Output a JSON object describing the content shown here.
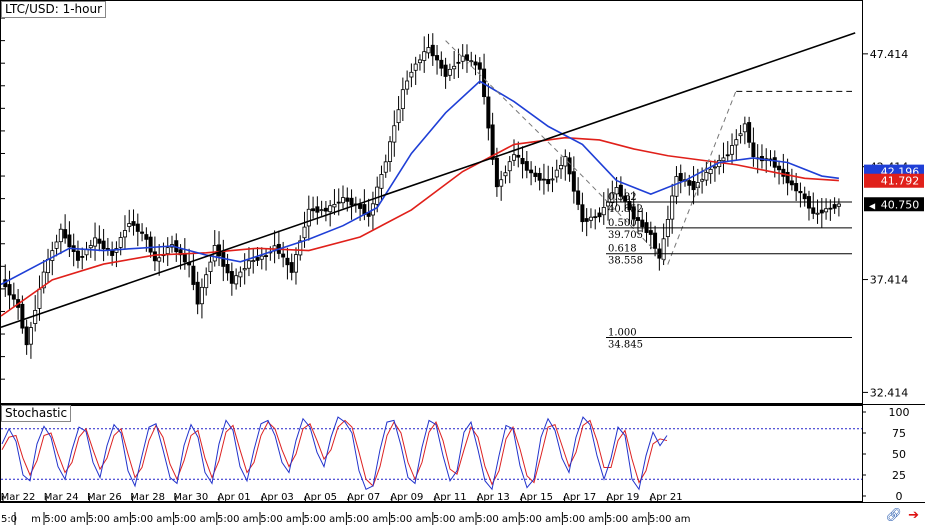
{
  "chart_data": {
    "type": "candlestick",
    "title": "LTC/USD: 1-hour",
    "price_axis": {
      "ticks": [
        "47.414",
        "42.414",
        "37.414",
        "32.414"
      ],
      "ylim": [
        31.9,
        49.8
      ]
    },
    "price_labels": {
      "ma_blue": "42.196",
      "ma_red": "41.792",
      "last": "40.750"
    },
    "colors": {
      "ma_blue": "#1f3fd6",
      "ma_red": "#e0201a",
      "last_label_bg": "#000000",
      "stoch_k": "#2233cc",
      "stoch_d": "#dd2222",
      "stoch_levels": "#2222cc"
    },
    "fib_levels": [
      {
        "ratio": "0.382",
        "price": "40.852"
      },
      {
        "ratio": "0.500",
        "price": "39.705"
      },
      {
        "ratio": "0.618",
        "price": "38.558"
      },
      {
        "ratio": "1.000",
        "price": "34.845"
      }
    ],
    "dates": [
      "Mar 22",
      "Mar 24",
      "Mar 26",
      "Mar 28",
      "Mar 30",
      "Apr 01",
      "Apr 03",
      "Apr 05",
      "Apr 07",
      "Apr 09",
      "Apr 11",
      "Apr 13",
      "Apr 15",
      "Apr 17",
      "Apr 19",
      "Apr 21"
    ],
    "times": [
      "5:0",
      "m",
      "5:00 am",
      "5:00 am",
      "5:00 am",
      "5:00 am",
      "5:00 am",
      "5:00 am",
      "5:00 am",
      "5:00 am",
      "5:00 am",
      "5:00 am",
      "5:00 am",
      "5:00 am",
      "5:00 am",
      "5:00 am",
      "5:00 am"
    ],
    "price_series": [
      [
        0,
        37.4
      ],
      [
        2,
        36.2
      ],
      [
        3,
        34.5
      ],
      [
        5,
        37.8
      ],
      [
        7,
        39.6
      ],
      [
        9,
        38.3
      ],
      [
        11,
        39.2
      ],
      [
        13,
        38.5
      ],
      [
        15,
        40.0
      ],
      [
        17,
        39.2
      ],
      [
        18,
        38.2
      ],
      [
        20,
        39.0
      ],
      [
        22,
        38.0
      ],
      [
        23,
        36.4
      ],
      [
        25,
        38.9
      ],
      [
        27,
        37.3
      ],
      [
        29,
        38.2
      ],
      [
        31,
        38.5
      ],
      [
        32,
        38.9
      ],
      [
        34,
        37.8
      ],
      [
        36,
        40.5
      ],
      [
        38,
        40.5
      ],
      [
        40,
        41.0
      ],
      [
        42,
        40.6
      ],
      [
        43,
        40.2
      ],
      [
        45,
        42.7
      ],
      [
        47,
        45.8
      ],
      [
        48,
        46.7
      ],
      [
        50,
        47.7
      ],
      [
        52,
        46.5
      ],
      [
        54,
        47.3
      ],
      [
        56,
        46.8
      ],
      [
        58,
        41.5
      ],
      [
        60,
        43.0
      ],
      [
        62,
        42.1
      ],
      [
        64,
        41.7
      ],
      [
        66,
        42.8
      ],
      [
        68,
        40.0
      ],
      [
        70,
        40.3
      ],
      [
        72,
        41.5
      ],
      [
        74,
        40.2
      ],
      [
        76,
        39.4
      ],
      [
        77,
        38.3
      ],
      [
        79,
        42.0
      ],
      [
        81,
        41.5
      ],
      [
        83,
        42.3
      ],
      [
        85,
        43.0
      ],
      [
        87,
        44.3
      ],
      [
        88,
        42.8
      ],
      [
        90,
        42.7
      ],
      [
        92,
        41.8
      ],
      [
        94,
        41.0
      ],
      [
        95,
        40.3
      ],
      [
        97,
        40.6
      ],
      [
        98,
        40.75
      ]
    ],
    "ma_blue_series": [
      [
        0,
        37.2
      ],
      [
        4,
        38.0
      ],
      [
        8,
        38.8
      ],
      [
        12,
        38.7
      ],
      [
        16,
        38.8
      ],
      [
        20,
        38.9
      ],
      [
        24,
        38.5
      ],
      [
        28,
        38.2
      ],
      [
        32,
        38.7
      ],
      [
        36,
        39.2
      ],
      [
        40,
        39.8
      ],
      [
        44,
        40.6
      ],
      [
        48,
        43.0
      ],
      [
        52,
        44.8
      ],
      [
        56,
        46.2
      ],
      [
        60,
        45.3
      ],
      [
        64,
        44.2
      ],
      [
        68,
        43.4
      ],
      [
        72,
        41.8
      ],
      [
        76,
        41.2
      ],
      [
        80,
        41.8
      ],
      [
        84,
        42.6
      ],
      [
        88,
        42.8
      ],
      [
        92,
        42.6
      ],
      [
        96,
        42.0
      ],
      [
        98,
        41.9
      ]
    ],
    "ma_red_series": [
      [
        0,
        35.8
      ],
      [
        6,
        37.4
      ],
      [
        12,
        38.1
      ],
      [
        18,
        38.5
      ],
      [
        24,
        38.6
      ],
      [
        30,
        38.8
      ],
      [
        36,
        38.7
      ],
      [
        42,
        39.3
      ],
      [
        48,
        40.5
      ],
      [
        54,
        42.2
      ],
      [
        60,
        43.4
      ],
      [
        66,
        43.7
      ],
      [
        70,
        43.6
      ],
      [
        74,
        43.2
      ],
      [
        78,
        42.9
      ],
      [
        82,
        42.7
      ],
      [
        86,
        42.5
      ],
      [
        90,
        42.2
      ],
      [
        94,
        41.9
      ],
      [
        98,
        41.8
      ]
    ],
    "trendline": [
      [
        0,
        35.3
      ],
      [
        124,
        48.7
      ]
    ],
    "swing_high": 45.75,
    "zigzag": [
      [
        52,
        48.0
      ],
      [
        68,
        42.0
      ],
      [
        78,
        38.1
      ],
      [
        86,
        45.8
      ]
    ],
    "stochastic": {
      "label": "Stochastic",
      "ticks": [
        "100",
        "75",
        "50",
        "25",
        "0"
      ],
      "levels": [
        80,
        20
      ],
      "k": [
        62,
        80,
        65,
        25,
        18,
        62,
        83,
        70,
        35,
        20,
        55,
        82,
        77,
        40,
        22,
        60,
        85,
        75,
        30,
        12,
        48,
        82,
        86,
        55,
        22,
        15,
        60,
        85,
        70,
        28,
        15,
        62,
        90,
        78,
        35,
        18,
        55,
        86,
        90,
        72,
        40,
        28,
        66,
        92,
        82,
        52,
        35,
        70,
        94,
        88,
        75,
        30,
        8,
        12,
        55,
        88,
        90,
        60,
        22,
        15,
        58,
        90,
        85,
        48,
        18,
        30,
        76,
        88,
        55,
        18,
        8,
        48,
        84,
        80,
        36,
        10,
        20,
        70,
        92,
        78,
        45,
        28,
        70,
        94,
        85,
        48,
        20,
        45,
        82,
        72,
        20,
        8,
        48,
        76,
        60,
        72
      ],
      "d": [
        55,
        70,
        72,
        45,
        25,
        42,
        72,
        75,
        50,
        28,
        40,
        70,
        80,
        55,
        32,
        45,
        72,
        80,
        50,
        22,
        34,
        66,
        84,
        70,
        38,
        20,
        42,
        72,
        78,
        45,
        22,
        42,
        76,
        84,
        55,
        28,
        40,
        72,
        88,
        80,
        55,
        35,
        50,
        80,
        86,
        66,
        44,
        55,
        82,
        90,
        82,
        52,
        20,
        12,
        35,
        72,
        88,
        75,
        40,
        20,
        40,
        76,
        88,
        66,
        32,
        26,
        55,
        82,
        70,
        35,
        14,
        30,
        68,
        82,
        56,
        24,
        16,
        48,
        82,
        85,
        60,
        35,
        52,
        84,
        90,
        66,
        34,
        34,
        66,
        78,
        44,
        16,
        30,
        62,
        68,
        66
      ]
    }
  }
}
